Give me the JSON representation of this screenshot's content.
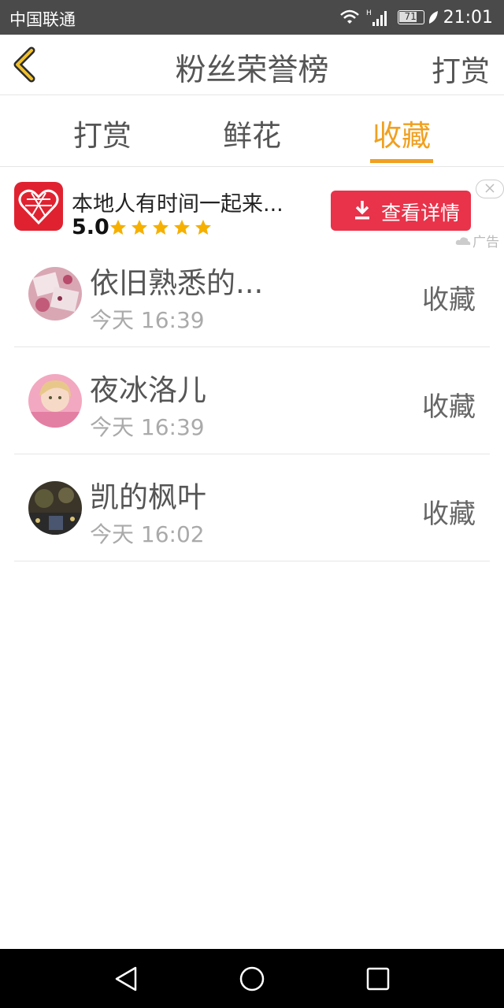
{
  "status_bar": {
    "carrier": "中国联通",
    "battery": "71",
    "time": "21:01",
    "network_mark": "H"
  },
  "header": {
    "title": "粉丝荣誉榜",
    "action_label": "打赏"
  },
  "tabs": [
    {
      "label": "打赏",
      "active": false
    },
    {
      "label": "鲜花",
      "active": false
    },
    {
      "label": "收藏",
      "active": true
    }
  ],
  "ad": {
    "title": "本地人有时间一起来...",
    "rating": "5.0",
    "stars": 5,
    "button_label": "查看详情",
    "tag": "广告"
  },
  "list": [
    {
      "name": "依旧熟悉的...",
      "time": "今天 16:39",
      "action": "收藏"
    },
    {
      "name": "夜冰洛儿",
      "time": "今天 16:39",
      "action": "收藏"
    },
    {
      "name": "凯的枫叶",
      "time": "今天 16:02",
      "action": "收藏"
    }
  ],
  "colors": {
    "accent": "#f0a020",
    "ad_button": "#e8334a",
    "status_bar": "#4a4a4a",
    "nav_bar": "#000000"
  }
}
